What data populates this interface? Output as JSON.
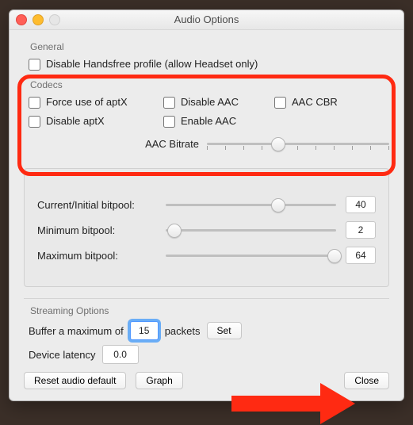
{
  "window": {
    "title": "Audio Options"
  },
  "general": {
    "groupLabel": "General",
    "disableHandsfree": "Disable Handsfree profile (allow Headset only)"
  },
  "codecs": {
    "groupLabel": "Codecs",
    "forceAptx": "Force use of aptX",
    "disableAptx": "Disable aptX",
    "disableAac": "Disable AAC",
    "enableAac": "Enable AAC",
    "aacCbr": "AAC CBR",
    "aacBitrateLabel": "AAC Bitrate"
  },
  "bitpool": {
    "currentLabel": "Current/Initial bitpool:",
    "currentValue": "40",
    "minLabel": "Minimum bitpool:",
    "minValue": "2",
    "maxLabel": "Maximum bitpool:",
    "maxValue": "64"
  },
  "streaming": {
    "groupLabel": "Streaming Options",
    "bufferPrefix": "Buffer a maximum of",
    "bufferValue": "15",
    "bufferSuffix": "packets",
    "setLabel": "Set",
    "latencyLabel": "Device latency",
    "latencyValue": "0.0"
  },
  "buttons": {
    "reset": "Reset audio default",
    "graph": "Graph",
    "close": "Close"
  }
}
